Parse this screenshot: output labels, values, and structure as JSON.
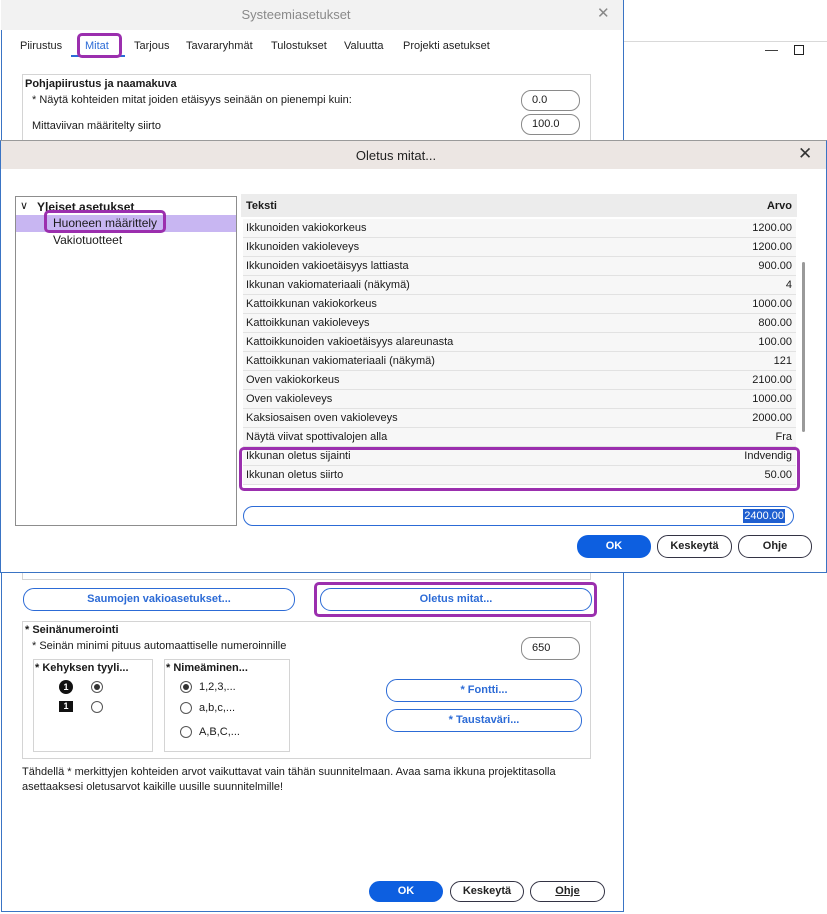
{
  "outer_window": {
    "title": "Systeemiasetukset",
    "close_glyph": "✕",
    "tabs": [
      "Piirustus",
      "Mitat",
      "Tarjous",
      "Tavararyhmät",
      "Tulostukset",
      "Valuutta",
      "Projekti asetukset"
    ],
    "section_title": "Pohjapiirustus ja naamakuva",
    "dimension_threshold_label": "* Näytä kohteiden mitat joiden etäisyys seinään on pienempi kuin:",
    "dimension_threshold_value": "0.0",
    "dimension_offset_label": "Mittaviivan määritelty siirto",
    "dimension_offset_value": "100.0",
    "joint_defaults_button": "Saumojen vakioasetukset...",
    "default_dimensions_button": "Oletus mitat...",
    "wall_numbering": {
      "title": "* Seinänumerointi",
      "min_length_label": "* Seinän minimi pituus automaattiselle numeroinnille",
      "min_length_value": "650",
      "frame_style_title": "* Kehyksen tyyli...",
      "frame_glyph_1": "1",
      "frame_glyph_2": "1",
      "naming_title": "* Nimeäminen...",
      "naming_options": [
        "1,2,3,...",
        "a,b,c,...",
        "A,B,C,..."
      ],
      "font_button": "* Fontti...",
      "background_button": "* Taustaväri..."
    },
    "footer_note": "Tähdellä * merkittyjen kohteiden arvot vaikuttavat vain tähän suunnitelmaan. Avaa sama ikkuna projektitasolla asettaaksesi oletusarvot kaikille uusille suunnitelmille!",
    "ok_button": "OK",
    "cancel_button": "Keskeytä",
    "help_button": "Ohje"
  },
  "modal": {
    "title": "Oletus mitat...",
    "close_glyph": "✕",
    "tree": {
      "root": "Yleiset asetukset",
      "items": [
        "Huoneen määrittely",
        "Vakiotuotteet"
      ],
      "selected": "Huoneen määrittely"
    },
    "grid": {
      "columns": [
        "Teksti",
        "Arvo"
      ],
      "rows": [
        [
          "Ikkunoiden vakiokorkeus",
          "1200.00"
        ],
        [
          "Ikkunoiden vakioleveys",
          "1200.00"
        ],
        [
          "Ikkunoiden vakioetäisyys lattiasta",
          "900.00"
        ],
        [
          "Ikkunan vakiomateriaali (näkymä)",
          "4"
        ],
        [
          "Kattoikkunan vakiokorkeus",
          "1000.00"
        ],
        [
          "Kattoikkunan vakioleveys",
          "800.00"
        ],
        [
          "Kattoikkunoiden vakioetäisyys alareunasta",
          "100.00"
        ],
        [
          "Kattoikkunan vakiomateriaali (näkymä)",
          "121"
        ],
        [
          "Oven vakiokorkeus",
          "2100.00"
        ],
        [
          "Oven vakioleveys",
          "1000.00"
        ],
        [
          "Kaksiosaisen oven vakioleveys",
          "2000.00"
        ],
        [
          "Näytä viivat spottivalojen alla",
          "Fra"
        ],
        [
          "Ikkunan oletus sijainti",
          "Indvendig"
        ],
        [
          "Ikkunan oletus siirto",
          "50.00"
        ]
      ]
    },
    "edit_value": "2400.00",
    "ok_button": "OK",
    "cancel_button": "Keskeytä",
    "help_button": "Ohje"
  },
  "colors": {
    "accent": "#2c6bd6",
    "primary_button": "#0d5fe0",
    "highlight_outline": "#9b2fae",
    "tree_selection": "#c8b6f2"
  }
}
